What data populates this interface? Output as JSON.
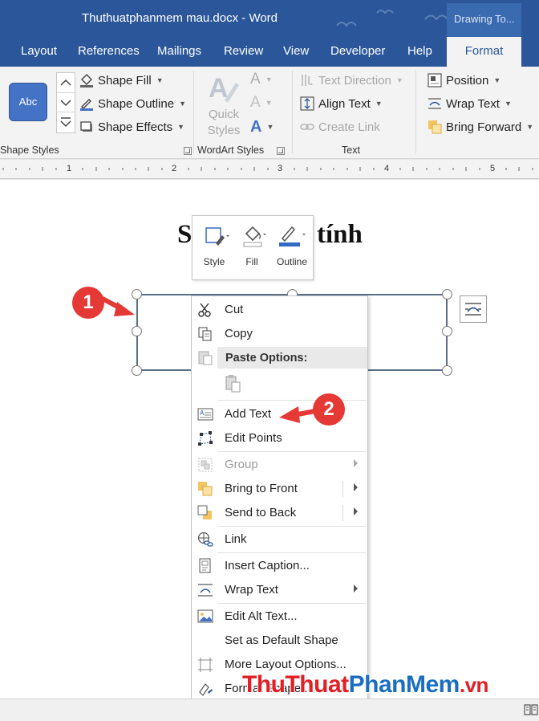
{
  "window": {
    "title": "Thuthuatphanmem mau.docx  -  Word",
    "context_group": "Drawing To..."
  },
  "tabs": [
    "Layout",
    "References",
    "Mailings",
    "Review",
    "View",
    "Developer",
    "Help"
  ],
  "active_tab": "Format",
  "ribbon": {
    "shape_styles": {
      "preview": "Abc",
      "shape_fill": "Shape Fill",
      "shape_outline": "Shape Outline",
      "shape_effects": "Shape Effects",
      "label": "Shape Styles"
    },
    "wordart_styles": {
      "quick_styles_line1": "Quick",
      "quick_styles_line2": "Styles",
      "label": "WordArt Styles"
    },
    "text": {
      "text_direction": "Text Direction",
      "align_text": "Align Text",
      "create_link": "Create Link",
      "label": "Text"
    },
    "arrange": {
      "position": "Position",
      "wrap_text": "Wrap Text",
      "bring_forward": "Bring Forward"
    }
  },
  "ruler": [
    "1",
    "2",
    "3",
    "4",
    "5"
  ],
  "document": {
    "heading_left": "S",
    "heading_right": "tính"
  },
  "mini_toolbar": {
    "style": "Style",
    "fill": "Fill",
    "outline": "Outline"
  },
  "context_menu": {
    "cut": "Cut",
    "copy": "Copy",
    "paste_options": "Paste Options:",
    "add_text": "Add Text",
    "edit_points": "Edit Points",
    "group": "Group",
    "bring_to_front": "Bring to Front",
    "send_to_back": "Send to Back",
    "link": "Link",
    "insert_caption": "Insert Caption...",
    "wrap_text": "Wrap Text",
    "edit_alt_text": "Edit Alt Text...",
    "set_default_shape": "Set as Default Shape",
    "more_layout_options": "More Layout Options...",
    "format_shape": "Format Shape..."
  },
  "callouts": {
    "step1": "1",
    "step2": "2"
  },
  "watermark": {
    "part1": "Thu",
    "part2": "Thuat",
    "part3": "PhanMem",
    "part4": ".vn"
  },
  "colors": {
    "title_bar": "#2b579a",
    "accent": "#4472c4",
    "callout": "#e53935"
  }
}
